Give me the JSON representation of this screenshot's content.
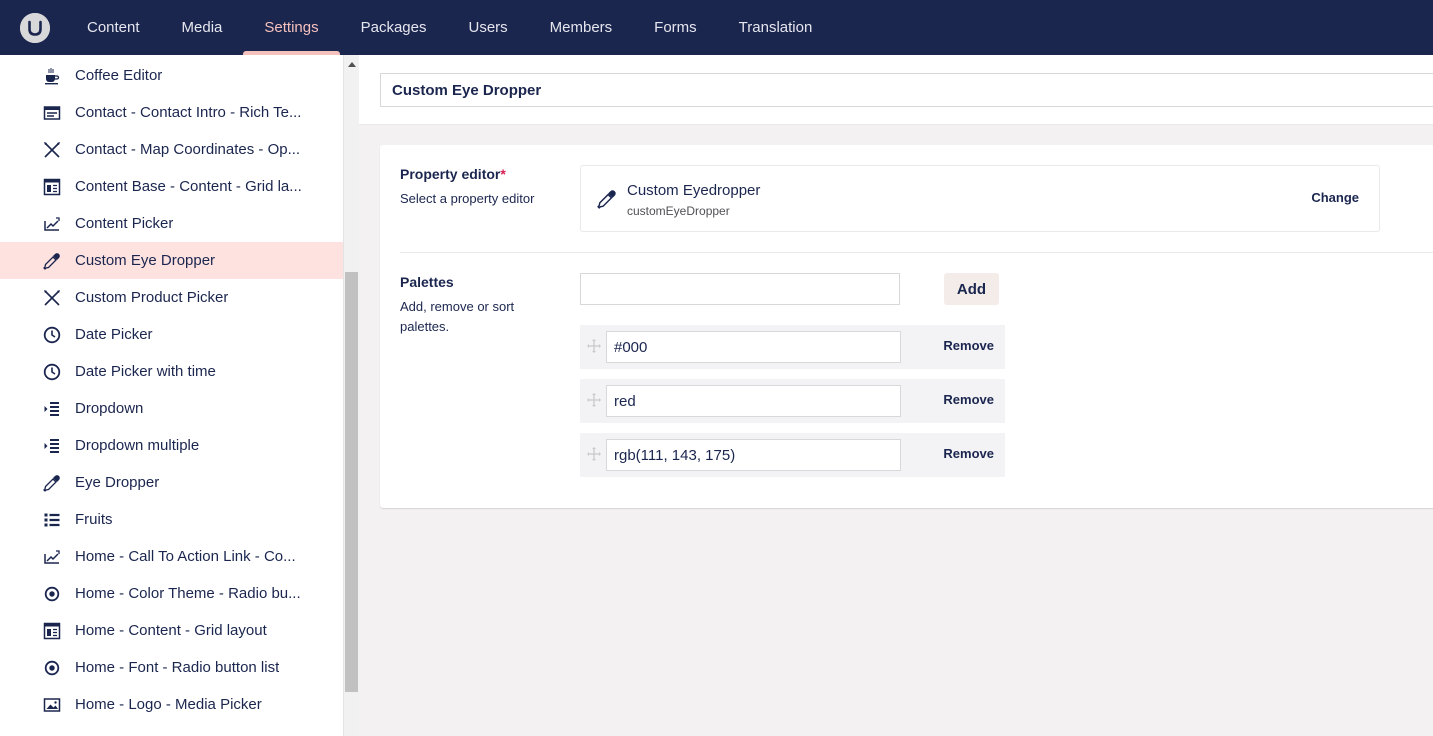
{
  "nav": {
    "items": [
      {
        "label": "Content"
      },
      {
        "label": "Media"
      },
      {
        "label": "Settings"
      },
      {
        "label": "Packages"
      },
      {
        "label": "Users"
      },
      {
        "label": "Members"
      },
      {
        "label": "Forms"
      },
      {
        "label": "Translation"
      }
    ],
    "active": "Settings"
  },
  "sidebar": {
    "items": [
      {
        "label": "Coffee Editor",
        "icon": "coffee-icon"
      },
      {
        "label": "Contact - Contact Intro - Rich Te...",
        "icon": "rich-text-icon"
      },
      {
        "label": "Contact - Map Coordinates - Op...",
        "icon": "crossed-tools-icon"
      },
      {
        "label": "Content Base - Content - Grid la...",
        "icon": "grid-layout-icon"
      },
      {
        "label": "Content Picker",
        "icon": "content-picker-icon"
      },
      {
        "label": "Custom Eye Dropper",
        "icon": "eyedropper-icon",
        "selected": true
      },
      {
        "label": "Custom Product Picker",
        "icon": "crossed-tools-icon"
      },
      {
        "label": "Date Picker",
        "icon": "clock-icon"
      },
      {
        "label": "Date Picker with time",
        "icon": "clock-icon"
      },
      {
        "label": "Dropdown",
        "icon": "dropdown-list-icon"
      },
      {
        "label": "Dropdown multiple",
        "icon": "dropdown-list-icon"
      },
      {
        "label": "Eye Dropper",
        "icon": "eyedropper-icon"
      },
      {
        "label": "Fruits",
        "icon": "bullet-list-icon"
      },
      {
        "label": "Home - Call To Action Link - Co...",
        "icon": "content-picker-icon"
      },
      {
        "label": "Home - Color Theme - Radio bu...",
        "icon": "radio-button-icon"
      },
      {
        "label": "Home - Content - Grid layout",
        "icon": "grid-layout-icon"
      },
      {
        "label": "Home - Font - Radio button list",
        "icon": "radio-button-icon"
      },
      {
        "label": "Home - Logo - Media Picker",
        "icon": "image-icon"
      }
    ]
  },
  "datatype": {
    "name": "Custom Eye Dropper"
  },
  "property_editor": {
    "label": "Property editor",
    "required_mark": "*",
    "description": "Select a property editor",
    "name": "Custom Eyedropper",
    "alias": "customEyeDropper",
    "change_label": "Change",
    "icon": "eyedropper-icon"
  },
  "palettes": {
    "label": "Palettes",
    "description": "Add, remove or sort palettes.",
    "new_value": "",
    "add_label": "Add",
    "remove_label": "Remove",
    "items": [
      {
        "value": "#000"
      },
      {
        "value": "red"
      },
      {
        "value": "rgb(111, 143, 175)"
      }
    ]
  }
}
